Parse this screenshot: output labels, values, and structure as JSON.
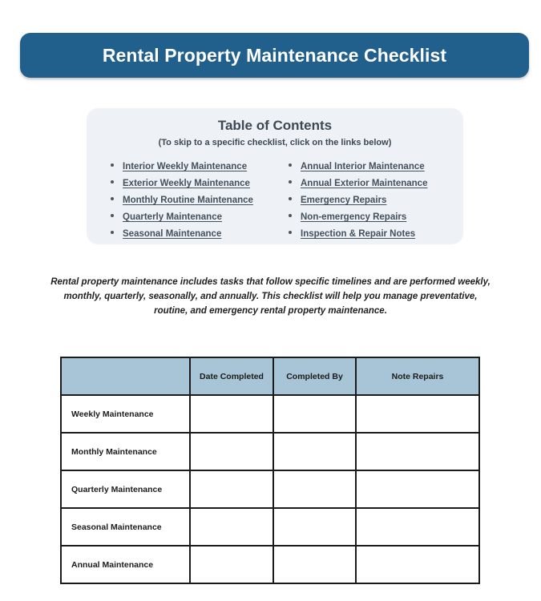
{
  "banner": {
    "title": "Rental Property Maintenance Checklist",
    "bg_color": "#215f8c",
    "text_color": "#ffffff"
  },
  "toc": {
    "heading": "Table of Contents",
    "subtitle": "(To skip to a specific checklist, click on the links below)",
    "panel_bg": "#eef2f7",
    "link_color": "#44505c",
    "left_links": [
      "Interior Weekly Maintenance",
      "Exterior Weekly Maintenance",
      "Monthly Routine Maintenance",
      "Quarterly Maintenance",
      "Seasonal Maintenance"
    ],
    "right_links": [
      "Annual Interior Maintenance",
      "Annual Exterior Maintenance",
      "Emergency Repairs",
      "Non-emergency Repairs",
      "Inspection & Repair Notes"
    ]
  },
  "intro": {
    "text": "Rental property maintenance includes tasks that follow specific timelines and are performed weekly, monthly, quarterly, seasonally, and annually. This checklist will help you manage preventative, routine, and emergency rental property maintenance."
  },
  "table": {
    "header_bg": "#a8c5d7",
    "border_color": "#1b1b1b",
    "columns": [
      "",
      "Date Completed",
      "Completed By",
      "Note Repairs"
    ],
    "rows": [
      {
        "label": "Weekly Maintenance",
        "date_completed": "",
        "completed_by": "",
        "note_repairs": ""
      },
      {
        "label": "Monthly Maintenance",
        "date_completed": "",
        "completed_by": "",
        "note_repairs": ""
      },
      {
        "label": "Quarterly Maintenance",
        "date_completed": "",
        "completed_by": "",
        "note_repairs": ""
      },
      {
        "label": "Seasonal Maintenance",
        "date_completed": "",
        "completed_by": "",
        "note_repairs": ""
      },
      {
        "label": "Annual Maintenance",
        "date_completed": "",
        "completed_by": "",
        "note_repairs": ""
      }
    ]
  }
}
